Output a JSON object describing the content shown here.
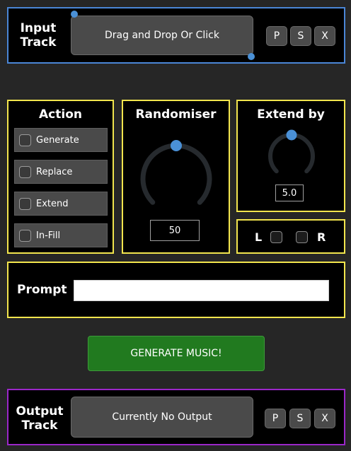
{
  "input_track": {
    "title": "Input\nTrack",
    "drop_label": "Drag and Drop Or Click",
    "buttons": [
      "P",
      "S",
      "X"
    ]
  },
  "action": {
    "title": "Action",
    "options": [
      "Generate",
      "Replace",
      "Extend",
      "In-Fill"
    ]
  },
  "randomiser": {
    "title": "Randomiser",
    "value": "50",
    "level": 0.5
  },
  "extend_by": {
    "title": "Extend by",
    "value": "5.0",
    "level": 0.5
  },
  "channels": {
    "left_label": "L",
    "right_label": "R"
  },
  "prompt": {
    "label": "Prompt",
    "value": ""
  },
  "generate_button": {
    "label": "GENERATE MUSIC!"
  },
  "output_track": {
    "title": "Output\nTrack",
    "status_label": "Currently No Output",
    "buttons": [
      "P",
      "S",
      "X"
    ]
  },
  "colors": {
    "accent_yellow": "#f2e54d",
    "input_border": "#4a86d6",
    "output_border": "#9b27c9",
    "knob_thumb": "#4a90d6",
    "generate_green": "#217a1f"
  }
}
